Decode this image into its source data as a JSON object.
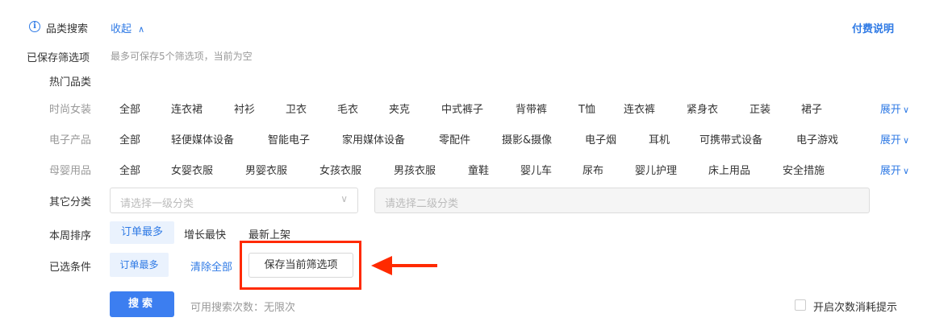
{
  "header": {
    "title": "品类搜索",
    "collapse_label": "收起",
    "payment_link": "付费说明"
  },
  "saved_filters": {
    "label": "已保存筛选项",
    "hint": "最多可保存5个筛选项，当前为空"
  },
  "hot_categories": {
    "label": "热门品类",
    "more_label": "展开",
    "groups": [
      {
        "name": "时尚女装",
        "items": [
          "全部",
          "连衣裙",
          "衬衫",
          "卫衣",
          "毛衣",
          "夹克",
          "中式裤子",
          "背带裤",
          "T恤",
          "连衣裤",
          "紧身衣",
          "正装",
          "裙子"
        ]
      },
      {
        "name": "电子产品",
        "items": [
          "全部",
          "轻便媒体设备",
          "智能电子",
          "家用媒体设备",
          "零配件",
          "摄影&摄像",
          "电子烟",
          "耳机",
          "可携带式设备",
          "电子游戏"
        ]
      },
      {
        "name": "母婴用品",
        "items": [
          "全部",
          "女婴衣服",
          "男婴衣服",
          "女孩衣服",
          "男孩衣服",
          "童鞋",
          "婴儿车",
          "尿布",
          "婴儿护理",
          "床上用品",
          "安全措施"
        ]
      }
    ]
  },
  "other_category": {
    "label": "其它分类",
    "level1_placeholder": "请选择一级分类",
    "level2_placeholder": "请选择二级分类"
  },
  "weekly_sort": {
    "label": "本周排序",
    "options": [
      "订单最多",
      "增长最快",
      "最新上架"
    ],
    "selected": "订单最多"
  },
  "selected_conditions": {
    "label": "已选条件",
    "tag": "订单最多",
    "clear_label": "清除全部",
    "save_button": "保存当前筛选项"
  },
  "search": {
    "button_label": "搜索",
    "quota_text": "可用搜索次数：无限次",
    "consumption_toggle_label": "开启次数消耗提示"
  },
  "colors": {
    "accent": "#2f7ae5",
    "primary_button": "#3c7ef0",
    "highlight": "#ff2a00"
  }
}
